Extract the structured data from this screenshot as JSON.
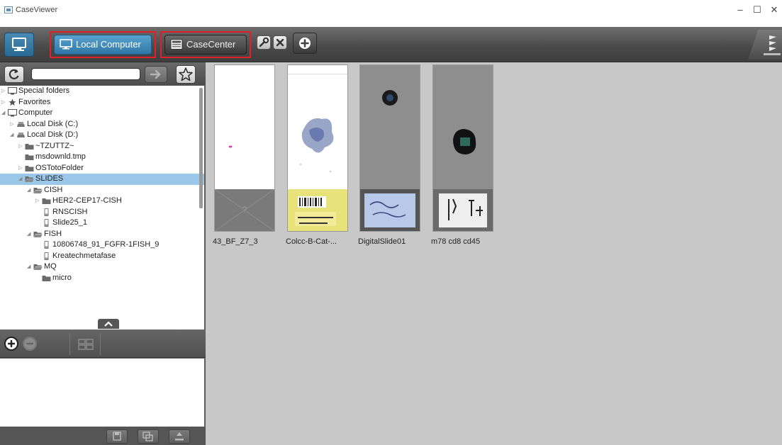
{
  "window": {
    "title": "CaseViewer",
    "controls": {
      "minimize": "–",
      "maximize": "☐",
      "close": "✕"
    }
  },
  "toolbar": {
    "local_computer_label": "Local Computer",
    "casecenter_label": "CaseCenter"
  },
  "browser": {
    "path_value": "",
    "tree": [
      {
        "label": "Special folders",
        "indent": 0,
        "toggle": "collapsed",
        "icon": "computer-icon"
      },
      {
        "label": "Favorites",
        "indent": 0,
        "toggle": "collapsed",
        "icon": "star-icon"
      },
      {
        "label": "Computer",
        "indent": 0,
        "toggle": "expanded",
        "icon": "computer-icon"
      },
      {
        "label": "Local Disk (C:)",
        "indent": 1,
        "toggle": "collapsed",
        "icon": "disk-icon"
      },
      {
        "label": "Local Disk (D:)",
        "indent": 1,
        "toggle": "expanded",
        "icon": "disk-icon"
      },
      {
        "label": "~TZUTTZ~",
        "indent": 2,
        "toggle": "collapsed",
        "icon": "folder-icon"
      },
      {
        "label": "msdownld.tmp",
        "indent": 2,
        "toggle": "none",
        "icon": "folder-icon"
      },
      {
        "label": "OSTotoFolder",
        "indent": 2,
        "toggle": "collapsed",
        "icon": "folder-icon"
      },
      {
        "label": "SLIDES",
        "indent": 2,
        "toggle": "expanded",
        "icon": "folder-open-icon",
        "selected": true
      },
      {
        "label": "CISH",
        "indent": 3,
        "toggle": "expanded",
        "icon": "folder-open-icon"
      },
      {
        "label": "HER2-CEP17-CISH",
        "indent": 4,
        "toggle": "collapsed",
        "icon": "folder-icon"
      },
      {
        "label": "RNSCISH",
        "indent": 4,
        "toggle": "none",
        "icon": "slide-icon"
      },
      {
        "label": "Slide25_1",
        "indent": 4,
        "toggle": "none",
        "icon": "slide-icon"
      },
      {
        "label": "FISH",
        "indent": 3,
        "toggle": "expanded",
        "icon": "folder-open-icon"
      },
      {
        "label": "10806748_91_FGFR-1FISH_9",
        "indent": 4,
        "toggle": "none",
        "icon": "slide-icon"
      },
      {
        "label": "Kreatechmetafase",
        "indent": 4,
        "toggle": "none",
        "icon": "slide-icon"
      },
      {
        "label": "MQ",
        "indent": 3,
        "toggle": "expanded",
        "icon": "folder-open-icon"
      },
      {
        "label": "micro",
        "indent": 4,
        "toggle": "none",
        "icon": "folder-icon"
      }
    ]
  },
  "slides": [
    {
      "label": "43_BF_Z7_3",
      "style": "white"
    },
    {
      "label": "Colcc-B-Cat-...",
      "style": "tissue"
    },
    {
      "label": "DigitalSlide01",
      "style": "gray-dot"
    },
    {
      "label": "m78 cd8 cd45",
      "style": "gray-blob"
    }
  ],
  "colors": {
    "accent_blue": "#2f77a6",
    "highlight_red": "#e0202a",
    "selection": "#9bc7e8",
    "content_bg": "#c8c8c8"
  }
}
